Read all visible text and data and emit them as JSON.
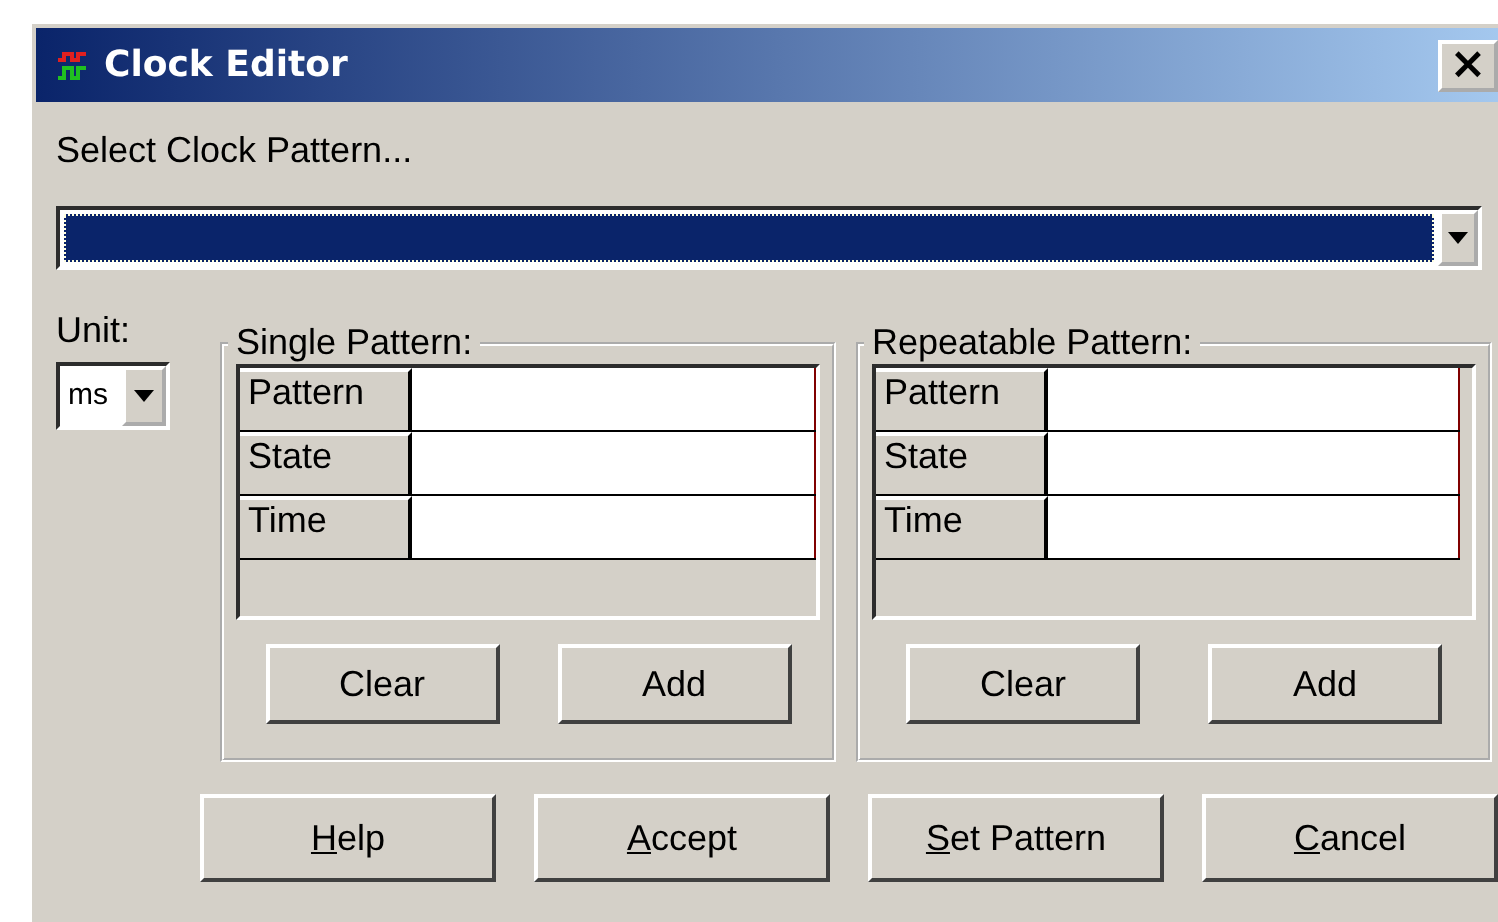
{
  "window": {
    "title": "Clock Editor",
    "close": "×"
  },
  "prompt": "Select Clock Pattern...",
  "pattern_select": {
    "focused": true
  },
  "unit": {
    "label": "Unit:",
    "value": "ms"
  },
  "groups": [
    {
      "title": "Single Pattern:",
      "rows": [
        {
          "label": "Pattern"
        },
        {
          "label": "State"
        },
        {
          "label": "Time"
        }
      ],
      "buttons": [
        "Clear",
        "Add"
      ]
    },
    {
      "title": "Repeatable Pattern:",
      "rows": [
        {
          "label": "Pattern"
        },
        {
          "label": "State"
        },
        {
          "label": "Time"
        }
      ],
      "buttons": [
        "Clear",
        "Add"
      ]
    }
  ],
  "buttons": [
    {
      "mnemonic": "H",
      "rest": "elp"
    },
    {
      "mnemonic": "A",
      "rest": "ccept"
    },
    {
      "mnemonic": "S",
      "rest": "et Pattern"
    },
    {
      "mnemonic": "C",
      "rest": "ancel"
    }
  ]
}
